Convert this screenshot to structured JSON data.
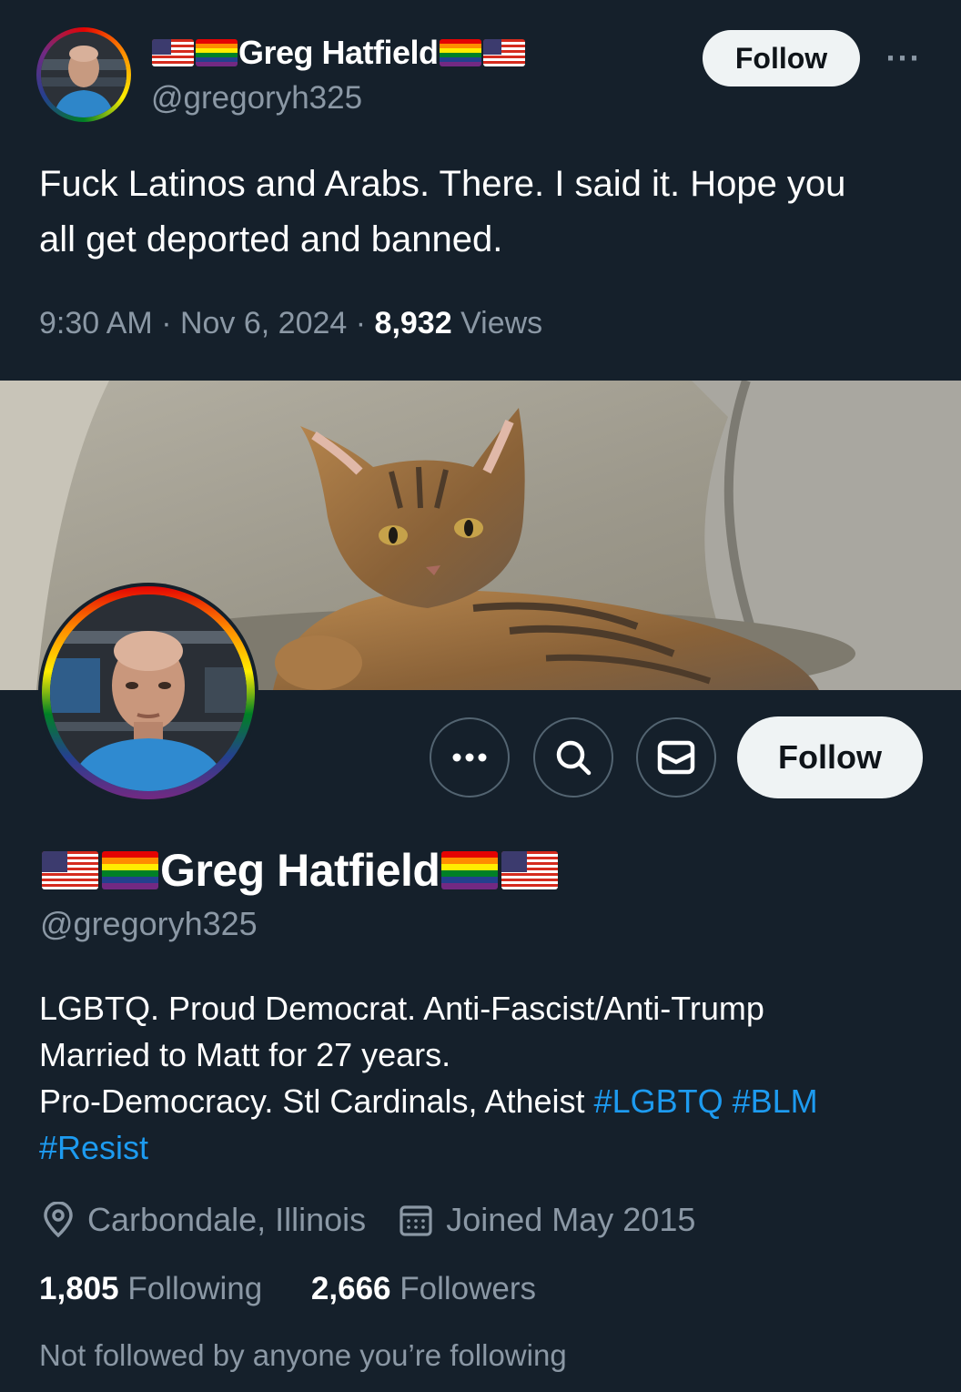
{
  "tweet": {
    "author_name": "Greg Hatfield",
    "author_handle": "@gregoryh325",
    "follow_label": "Follow",
    "more_label": "···",
    "text_line1": "Fuck Latinos and Arabs. There. I said it. Hope you",
    "text_line2": "all get deported and banned.",
    "time": "9:30 AM",
    "date": "Nov 6, 2024",
    "separator": " · ",
    "views_count": "8,932",
    "views_label": "Views"
  },
  "profile": {
    "name": "Greg Hatfield",
    "handle": "@gregoryh325",
    "follow_label": "Follow",
    "bio_line1": "LGBTQ. Proud Democrat. Anti-Fascist/Anti-Trump",
    "bio_line2": "Married to Matt for 27 years.",
    "bio_line3_text": "Pro-Democracy. Stl Cardinals, Atheist ",
    "hashtag_lgbtq": "#LGBTQ",
    "hashtag_blm": "#BLM",
    "hashtag_resist": "#Resist",
    "location": "Carbondale, Illinois",
    "joined": "Joined May 2015",
    "following_count": "1,805",
    "following_label": "Following",
    "followers_count": "2,666",
    "followers_label": "Followers",
    "not_followed_text": "Not followed by anyone you’re following"
  },
  "icons": {
    "name_decoration": [
      "us-flag-icon",
      "rainbow-flag-icon"
    ],
    "actions": [
      "more-icon",
      "search-icon",
      "mail-icon"
    ],
    "meta": [
      "location-icon",
      "calendar-icon"
    ]
  },
  "colors": {
    "background": "#15202b",
    "secondary_text": "#8b98a5",
    "link": "#1d9bf0",
    "button_bg": "#eff3f4"
  }
}
